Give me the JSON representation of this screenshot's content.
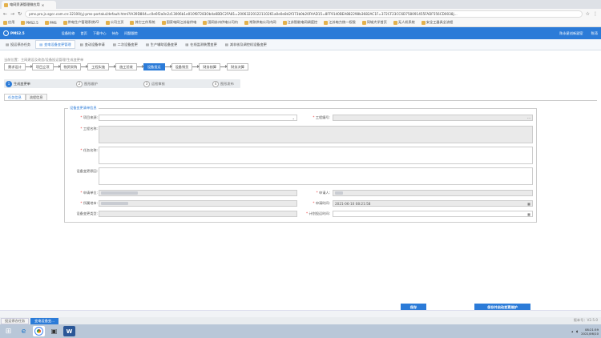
{
  "browser": {
    "tab_title": "电网资源管理微应用",
    "url": "pms.pro.js.sgcc.com.cn:32100/yj-pms-portalui/default.html?lA39D804=c0e6f2a0n2z13006b1e010f87283Ob4a6BDC2FA81=20063220122110261a0e0e8d2f373b0b20FAAD15=8FF9140BEA882298b3682AC1F=372CF23CC6D758091455FADF556CD0038j..."
  },
  "bookmarks": [
    "应用",
    "PMS2.5",
    "PMS",
    "供电生产管理系统V2",
    "公司主页",
    "其它工作系统",
    "国家电网江苏省供电",
    "国网苏州供电公司内",
    "常熟供电公司内网",
    "江苏智能电网调度控",
    "江苏电力统一权限",
    "同城大学首页",
    "无人机系统",
    "安全工器具全流程"
  ],
  "appbar": {
    "brand": "PMS2.5",
    "nav": [
      "设备检修",
      "首页",
      "下载中心",
      "待办",
      "问题跟踪"
    ],
    "user": "陈永星创新副室",
    "profile": "陈涛"
  },
  "modtabs": [
    "投运停办任务",
    "变电设备变更管理",
    "变动设备申请",
    "二次设备变更",
    "生产辅助设备变更",
    "在线监测装置变更",
    "减非核及调控机设备变更"
  ],
  "breadcrumb": "当前位置：主网建设及改造/设备投运管理/生成变更单",
  "flow": [
    "需求设计",
    "项目立项",
    "物资采购",
    "工程实施",
    "施工验收",
    "设备投运",
    "设备销货",
    "财务核算",
    "财务决算"
  ],
  "steps": [
    "生成变更单",
    "图形维护",
    "运检审核",
    "图形发布"
  ],
  "subtabs": [
    "任务信息",
    "流程信息"
  ],
  "form": {
    "legend": "设备变更清单信息",
    "project_source_label": "项目来源:",
    "project_no_label": "工程编号:",
    "project_name_label": "工程名称:",
    "task_name_label": "任务名称:",
    "reason_label": "设备变更原因:",
    "apply_unit_label": "申请单位:",
    "applicant_label": "申请人:",
    "owner_unit_label": "所属地市:",
    "apply_time_label": "申请时间:",
    "change_type_label": "设备变更类型:",
    "plan_date_label": "计划投运时间:",
    "apply_time_value": "2021-06-10 08:21:58"
  },
  "buttons": {
    "save": "保存",
    "save_start": "保存并启动变更维护"
  },
  "bottom_tabs": [
    "投运停办任务",
    "变电设备变..."
  ],
  "version": "版本号：V2.5.0",
  "clock": {
    "time": "08:21:59",
    "date": "2021/06/10"
  },
  "colors": {
    "primary": "#2b7bd8",
    "taskbar": "#b9c7d8"
  }
}
